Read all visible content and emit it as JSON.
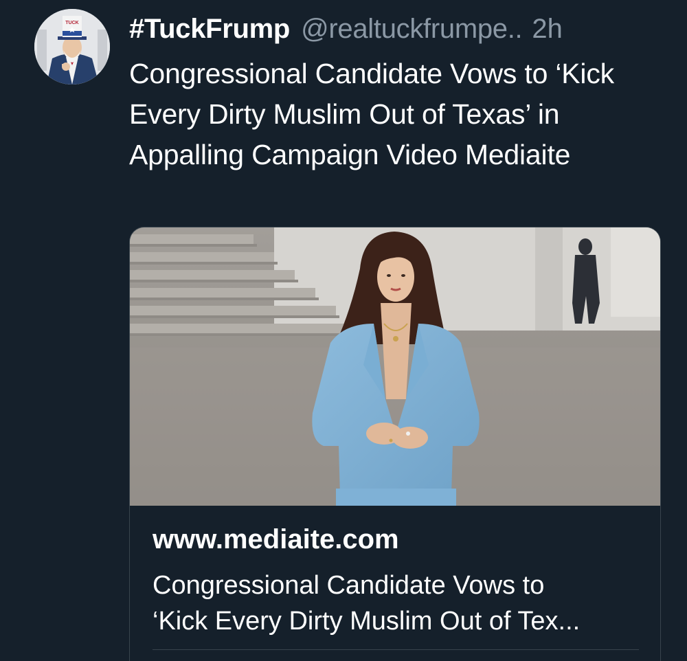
{
  "tweet": {
    "display_name": "#TuckFrump",
    "handle": "@realtuckfrumpe..",
    "time": "2h",
    "text": "Congressional Candidate Vows to ‘Kick Every Dirty Muslim Out of Texas’ in Appalling Campaign Video Mediaite",
    "avatar": {
      "icon": "uncle-sam-avatar-icon",
      "hat_text": "TUCK"
    }
  },
  "card": {
    "domain": "www.mediaite.com",
    "title": "Congressional Candidate Vows to\n‘Kick Every Dirty Muslim Out of Tex..."
  },
  "colors": {
    "background": "#15202b",
    "text_primary": "#ffffff",
    "text_secondary": "#8b98a5",
    "border": "#38444d",
    "suit": "#7fb1d6"
  }
}
